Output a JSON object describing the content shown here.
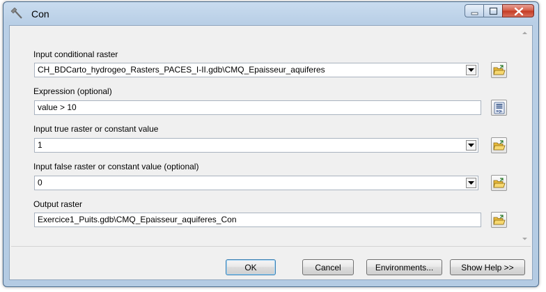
{
  "window": {
    "title": "Con"
  },
  "form": {
    "input_conditional": {
      "label": "Input conditional raster",
      "value": "CH_BDCarto_hydrogeo_Rasters_PACES_I-II.gdb\\CMQ_Epaisseur_aquiferes"
    },
    "expression": {
      "label": "Expression (optional)",
      "value": "value > 10"
    },
    "input_true": {
      "label": "Input true raster or constant value",
      "value": "1"
    },
    "input_false": {
      "label": "Input false raster or constant value (optional)",
      "value": "0"
    },
    "output_raster": {
      "label": "Output raster",
      "value": "Exercice1_Puits.gdb\\CMQ_Epaisseur_aquiferes_Con"
    }
  },
  "buttons": {
    "ok": "OK",
    "cancel": "Cancel",
    "environments": "Environments...",
    "show_help": "Show Help >>"
  },
  "icons": {
    "app": "hammer-icon",
    "browse": "open-folder-icon",
    "sql": "sql-query-icon"
  },
  "colors": {
    "title_bar": "#b9cfe6",
    "close_button": "#c43a22",
    "client_bg": "#f0f0f0",
    "folder_yellow": "#f2c94c"
  }
}
